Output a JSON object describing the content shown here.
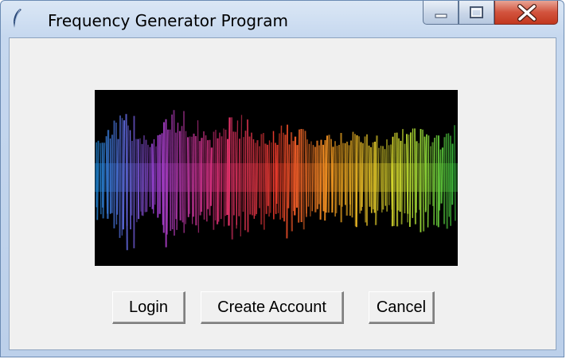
{
  "window": {
    "title": "Frequency Generator Program",
    "icon": "feather-icon",
    "controls": [
      "minimize-icon",
      "maximize-icon",
      "close-icon"
    ]
  },
  "banner": {
    "image": "colorful-sound-waveform",
    "colors": [
      "#1f8fe0",
      "#9b3fd0",
      "#e0307a",
      "#e83a2a",
      "#f0a020",
      "#d8e030",
      "#30c040"
    ]
  },
  "buttons": {
    "login_label": "Login",
    "create_account_label": "Create Account",
    "cancel_label": "Cancel"
  }
}
